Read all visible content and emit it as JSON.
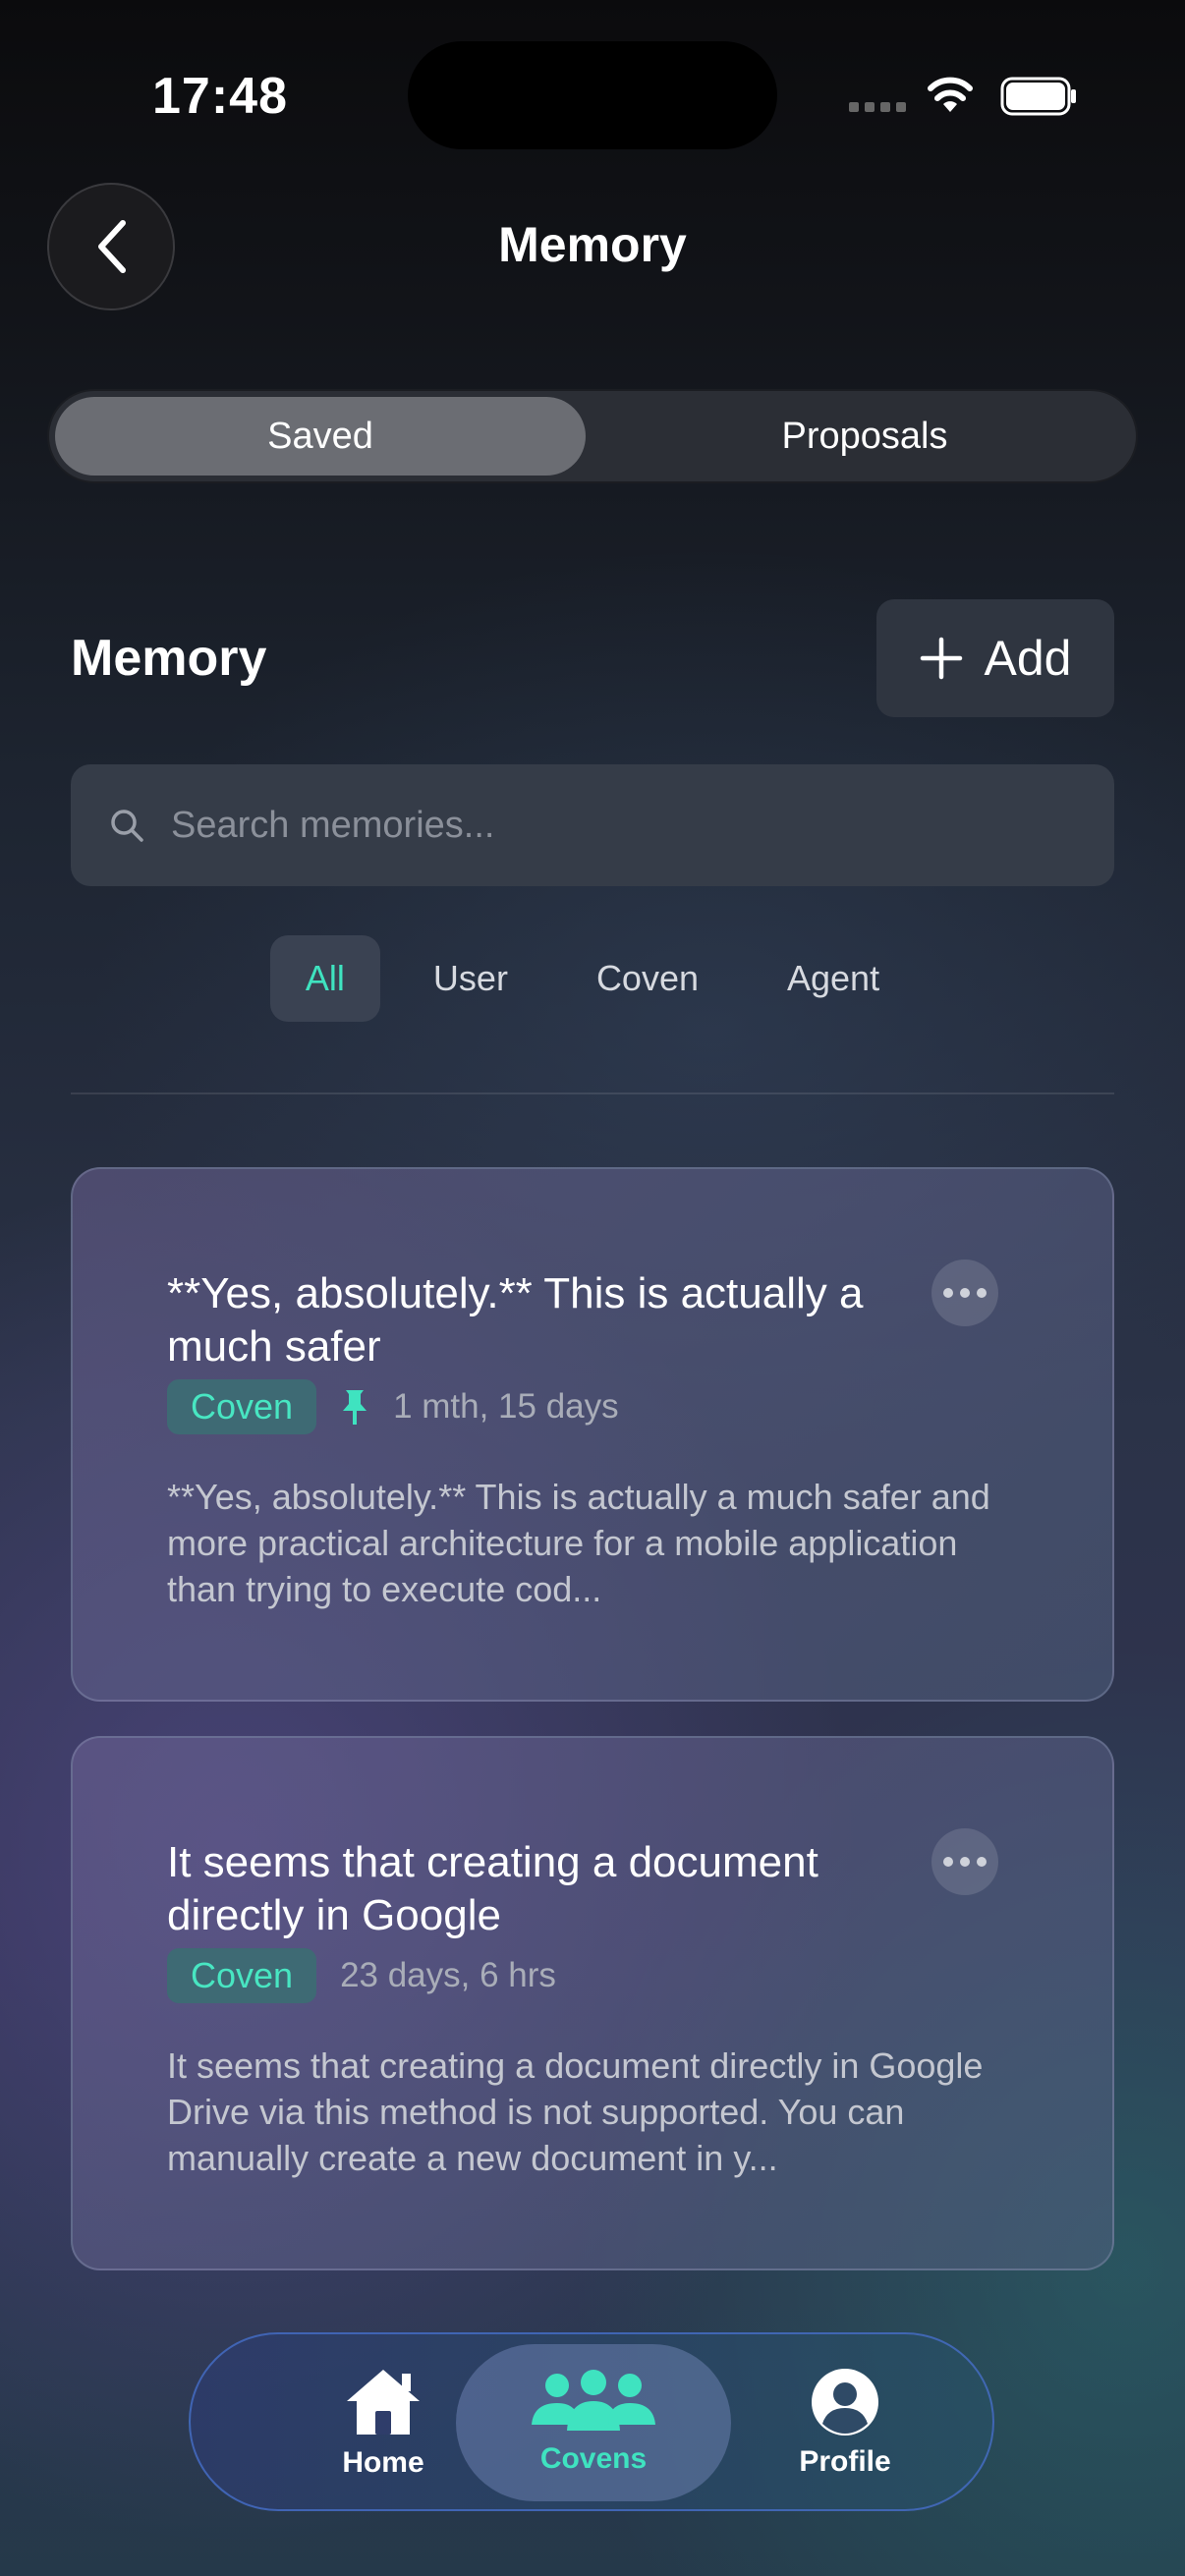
{
  "status_bar": {
    "time": "17:48"
  },
  "header": {
    "title": "Memory"
  },
  "segments": [
    {
      "label": "Saved",
      "active": true
    },
    {
      "label": "Proposals",
      "active": false
    }
  ],
  "section": {
    "title": "Memory",
    "add_label": "Add"
  },
  "search": {
    "placeholder": "Search memories..."
  },
  "filters": [
    "All",
    "User",
    "Coven",
    "Agent"
  ],
  "active_filter": "All",
  "memories": [
    {
      "title": "**Yes, absolutely.** This is actually a much safer",
      "tag": "Coven",
      "pinned": true,
      "age": "1 mth, 15 days",
      "body": "**Yes, absolutely.** This is actually a much safer and more practical architecture for a mobile application than trying to execute cod..."
    },
    {
      "title": "It seems that creating a document directly in Google",
      "tag": "Coven",
      "pinned": false,
      "age": "23 days, 6 hrs",
      "body": "It seems that creating a document directly in Google Drive via this method is not supported. You can manually create a new document in y..."
    }
  ],
  "nav": [
    {
      "label": "Home",
      "icon": "home-icon"
    },
    {
      "label": "Covens",
      "icon": "covens-icon",
      "active": true
    },
    {
      "label": "Profile",
      "icon": "profile-icon"
    }
  ],
  "colors": {
    "accent": "#3fe3c0",
    "tag_bg": "#3e6a74"
  }
}
